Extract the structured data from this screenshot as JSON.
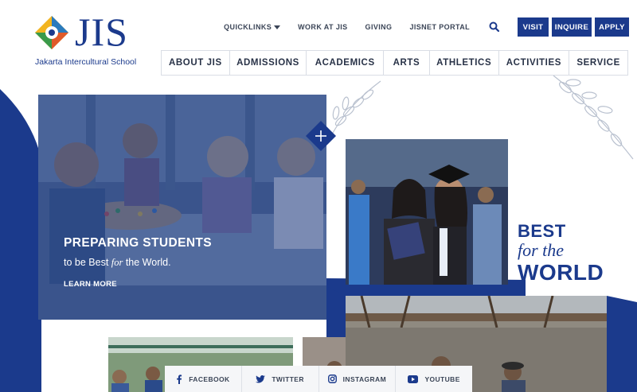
{
  "logo": {
    "mark_text": "JIS",
    "subtitle": "Jakarta Intercultural School"
  },
  "utility_nav": {
    "quicklinks": "QUICKLINKS",
    "work": "WORK AT JIS",
    "giving": "GIVING",
    "portal": "JISNET PORTAL",
    "search_icon": "search-icon",
    "buttons": {
      "visit": "VISIT",
      "inquire": "INQUIRE",
      "apply": "APPLY"
    }
  },
  "main_nav": {
    "items": [
      "ABOUT JIS",
      "ADMISSIONS",
      "ACADEMICS",
      "ARTS",
      "ATHLETICS",
      "ACTIVITIES",
      "SERVICE"
    ]
  },
  "hero": {
    "title": "PREPARING STUDENTS",
    "subtitle_pre": "to be Best ",
    "subtitle_em": "for",
    "subtitle_post": " the World.",
    "cta": "LEARN MORE",
    "expand_icon": "plus-icon"
  },
  "tagline": {
    "line1": "BEST",
    "line2": "for the",
    "line3": "WORLD"
  },
  "social": {
    "facebook": "FACEBOOK",
    "twitter": "TWITTER",
    "instagram": "INSTAGRAM",
    "youtube": "YOUTUBE"
  },
  "colors": {
    "brand_blue": "#1b3a8c",
    "nav_text": "#283247",
    "white": "#ffffff"
  }
}
